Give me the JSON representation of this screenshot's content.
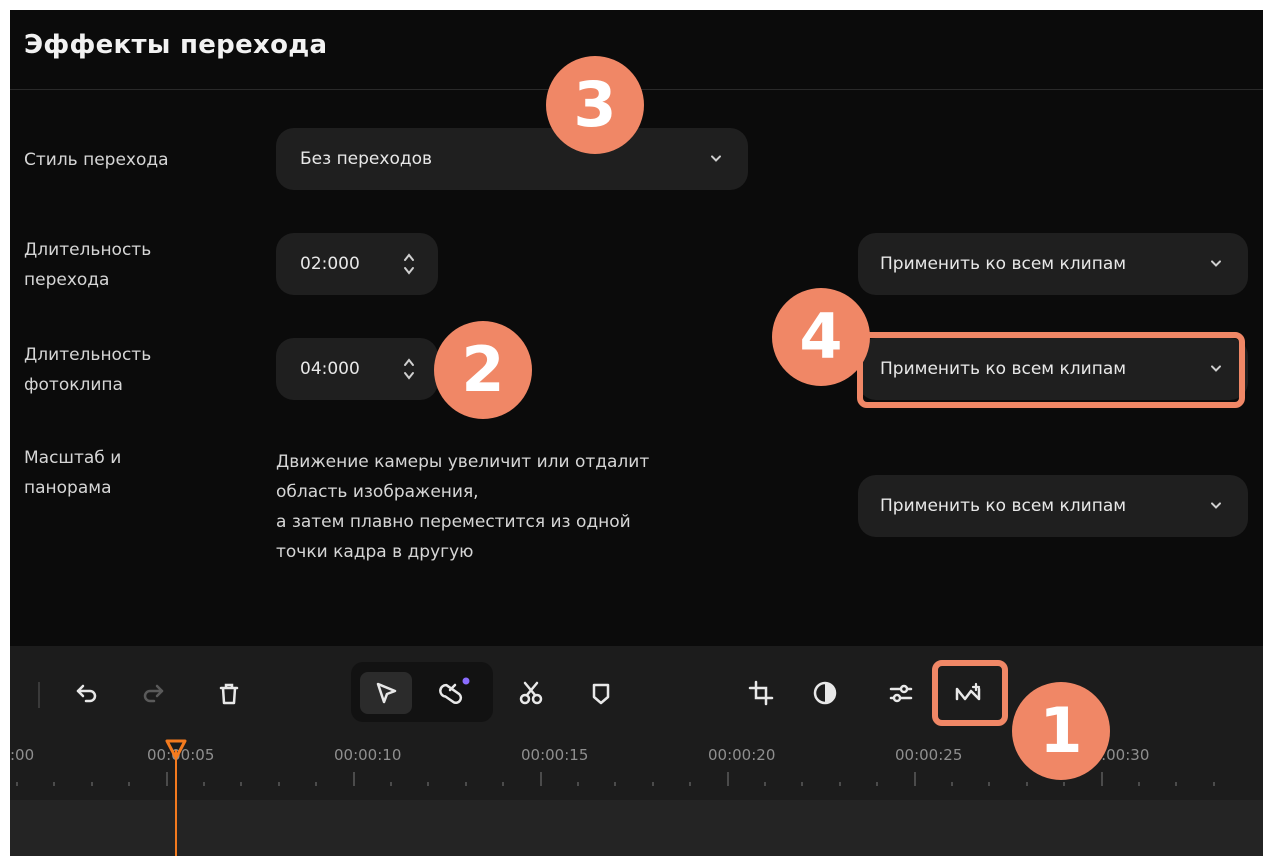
{
  "header": {
    "title": "Эффекты перехода"
  },
  "transition_style": {
    "label": "Стиль перехода",
    "value": "Без переходов",
    "icon": "chevron-down-icon"
  },
  "transition_duration": {
    "label_line1": "Длительность",
    "label_line2": "перехода",
    "value": "02:000",
    "apply_label": "Применить ко всем клипам"
  },
  "photo_duration": {
    "label_line1": "Длительность",
    "label_line2": "фотоклипа",
    "value": "04:000",
    "apply_label": "Применить ко всем клипам"
  },
  "pan_zoom": {
    "label_line1": "Масштаб и",
    "label_line2": "панорама",
    "description_lines": [
      "Движение камеры увеличит или отдалит",
      "область изображения,",
      "а затем плавно переместится из одной",
      "точки кадра в другую"
    ],
    "apply_label": "Применить ко всем клипам"
  },
  "toolbar": {
    "icons": [
      "undo-icon",
      "redo-icon",
      "delete-icon",
      "select-cursor-icon",
      "magnet-icon",
      "cut-icon",
      "marker-icon",
      "crop-icon",
      "color-icon",
      "adjust-icon",
      "transition-icon"
    ],
    "accent_color": "#f37a1e",
    "magnet_dot_color": "#8a6cff"
  },
  "timeline": {
    "ticks": [
      ":00",
      "00:00:05",
      "00:00:10",
      "00:00:15",
      "00:00:20",
      "00:00:25",
      "00:00:30"
    ]
  },
  "callouts": {
    "n1": "1",
    "n2": "2",
    "n3": "3",
    "n4": "4",
    "color": "#f08766"
  }
}
